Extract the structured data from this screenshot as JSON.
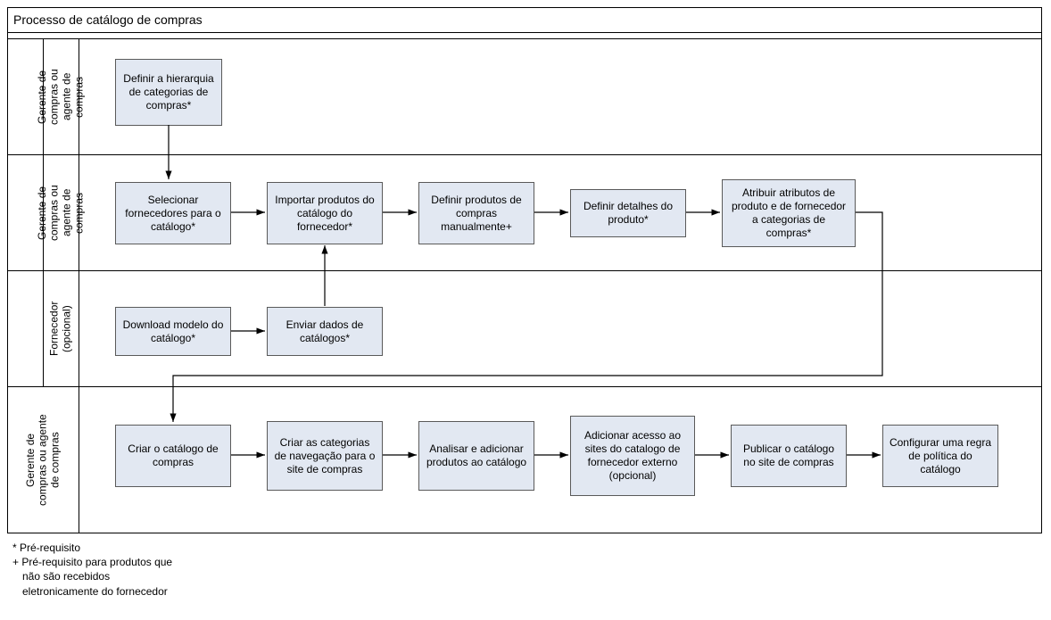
{
  "pool_title": "Processo de catálogo de compras",
  "lanes": {
    "lane1_label": "Gerente de\ncompras ou\nagente de\ncompras",
    "lane2_label": "Gerente de\ncompras ou\nagente de\ncompras",
    "lane3_label": "Fornecedor\n(opcional)",
    "lane4_label": "Gerente de\ncompras ou agente\nde compras"
  },
  "act": {
    "a1": "Definir a hierarquia de categorias de compras*",
    "b1": "Selecionar fornecedores para o catálogo*",
    "b2": "Importar produtos do catálogo do fornecedor*",
    "b3": "Definir produtos de compras manualmente+",
    "b4": "Definir detalhes do produto*",
    "b5": "Atribuir atributos de produto e de fornecedor a categorias de compras*",
    "c1": "Download modelo do catálogo*",
    "c2": "Enviar dados de catálogos*",
    "d1": "Criar o catálogo de compras",
    "d2": "Criar as categorias de navegação para o site de compras",
    "d3": "Analisar e adicionar produtos ao catálogo",
    "d4": "Adicionar acesso ao sites do catalogo de fornecedor externo (opcional)",
    "d5": "Publicar o catálogo no site de compras",
    "d6": "Configurar uma regra de política do catálogo"
  },
  "footnotes": {
    "star": "*  Pré-requisito",
    "plus": "+ Pré-requisito para produtos que não são recebidos eletronicamente do fornecedor"
  }
}
